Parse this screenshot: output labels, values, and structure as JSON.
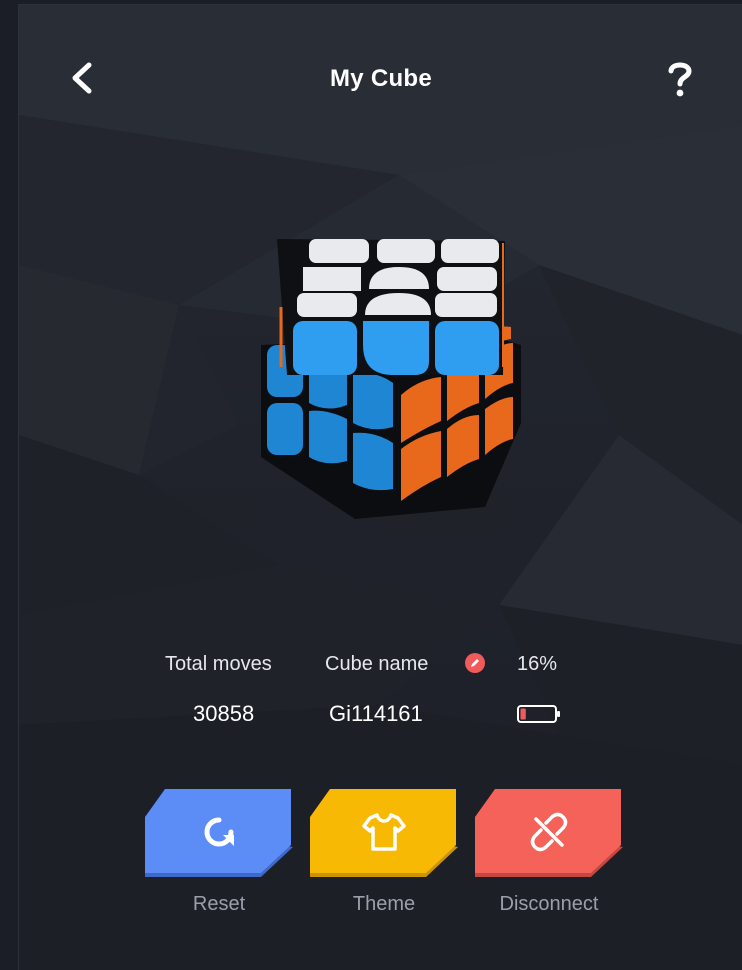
{
  "header": {
    "title": "My Cube",
    "back_icon": "chevron-left-icon",
    "help_icon": "question-mark-icon"
  },
  "cube": {
    "top_color": "#e9eaee",
    "front_color": "#2f9ef0",
    "right_color": "#e8681c",
    "left_color": "#1f86d4"
  },
  "info": {
    "total_moves_label": "Total moves",
    "total_moves_value": "30858",
    "cube_name_label": "Cube name",
    "cube_name_value": "Gi114161",
    "edit_icon": "pencil-icon",
    "battery_percent_label": "16%",
    "battery_level": 0.16,
    "battery_icon": "battery-icon"
  },
  "actions": [
    {
      "label": "Reset",
      "icon": "refresh-icon",
      "color": "#5c8cf6",
      "shadow": "#4068c8"
    },
    {
      "label": "Theme",
      "icon": "tshirt-icon",
      "color": "#f7b904",
      "shadow": "#c99304"
    },
    {
      "label": "Disconnect",
      "icon": "unlink-icon",
      "color": "#f4625a",
      "shadow": "#c44840"
    }
  ],
  "colors": {
    "accent_red": "#f05a5a",
    "background": "#22252d"
  }
}
